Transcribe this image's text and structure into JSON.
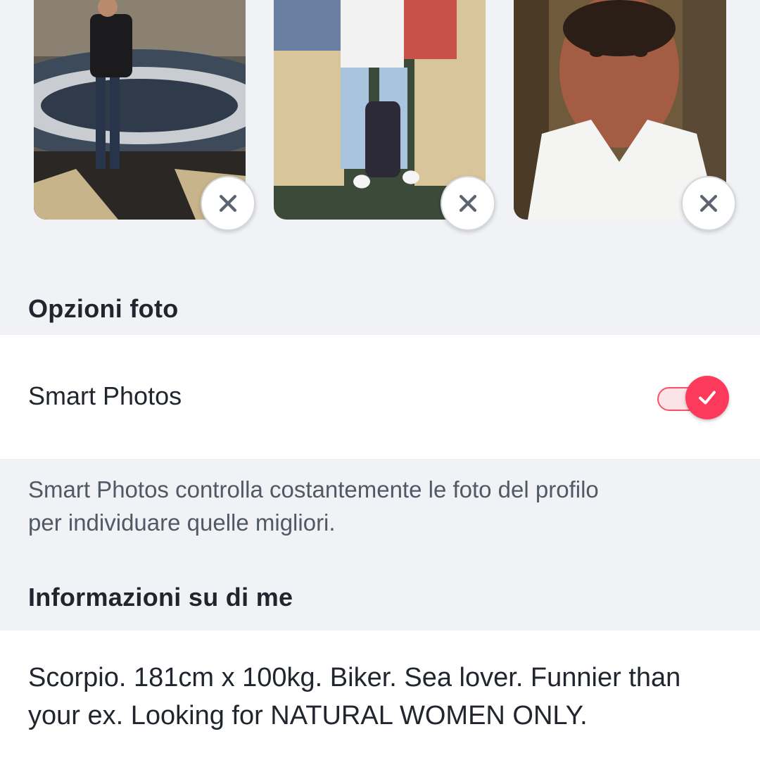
{
  "photos": [
    {
      "name": "profile-photo-1",
      "remove_icon": "close-icon"
    },
    {
      "name": "profile-photo-2",
      "remove_icon": "close-icon"
    },
    {
      "name": "profile-photo-3",
      "remove_icon": "close-icon"
    }
  ],
  "photo_options": {
    "title": "Opzioni foto",
    "smart_photos_label": "Smart Photos",
    "smart_photos_enabled": true,
    "toggle_icon": "checkmark-icon",
    "description": "Smart Photos controlla costantemente le foto del profilo per individuare quelle migliori."
  },
  "about": {
    "title": "Informazioni su di me",
    "bio": "Scorpio. 181cm x 100kg. Biker. Sea lover. Funnier than your ex. Looking for NATURAL WOMEN ONLY."
  },
  "colors": {
    "accent": "#fd3a5b",
    "background": "#f0f2f5",
    "card": "#ffffff",
    "text": "#21262e",
    "muted_text": "#505965"
  }
}
